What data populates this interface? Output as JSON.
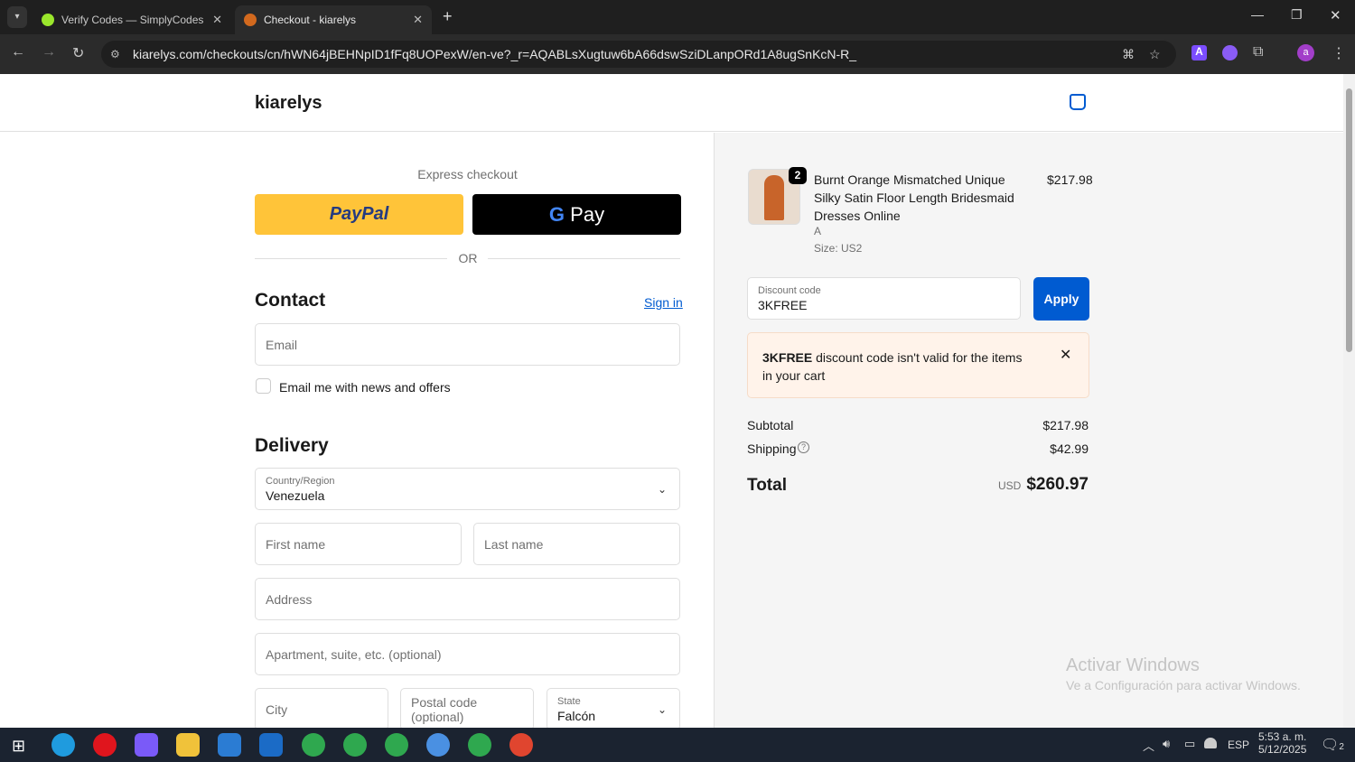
{
  "browser": {
    "tabs": [
      {
        "title": "Verify Codes — SimplyCodes"
      },
      {
        "title": "Checkout - kiarelys"
      }
    ],
    "url": "kiarelys.com/checkouts/cn/hWN64jBEHNpID1fFq8UOPexW/en-ve?_r=AQABLsXugtuw6bA66dswSziDLanpORd1A8ugSnKcN-R_",
    "profile_initial": "a"
  },
  "header": {
    "store_name": "kiarelys"
  },
  "checkout": {
    "express_label": "Express checkout",
    "paypal": "PayPal",
    "gpay": "Pay",
    "or": "OR",
    "contact": {
      "title": "Contact",
      "sign_in": "Sign in",
      "email_placeholder": "Email",
      "newsletter": "Email me with news and offers"
    },
    "delivery": {
      "title": "Delivery",
      "country_label": "Country/Region",
      "country": "Venezuela",
      "first_name": "First name",
      "last_name": "Last name",
      "address": "Address",
      "apartment": "Apartment, suite, etc. (optional)",
      "city": "City",
      "postal": "Postal code (optional)",
      "state_label": "State",
      "state": "Falcón"
    }
  },
  "summary": {
    "item": {
      "quantity": "2",
      "name": "Burnt Orange Mismatched Unique Silky Satin Floor Length Bridesmaid Dresses Online",
      "variant": "A",
      "size": "Size: US2",
      "price": "$217.98"
    },
    "discount_label": "Discount code",
    "discount_value": "3KFREE",
    "apply": "Apply",
    "error_code": "3KFREE",
    "error_text": " discount code isn't valid for the items in your cart",
    "subtotal_label": "Subtotal",
    "subtotal": "$217.98",
    "shipping_label": "Shipping",
    "shipping": "$42.99",
    "total_label": "Total",
    "currency": "USD",
    "total": "$260.97"
  },
  "watermark": {
    "title": "Activar Windows",
    "subtitle": "Ve a Configuración para activar Windows."
  },
  "taskbar": {
    "lang": "ESP",
    "time": "5:53 a. m.",
    "date": "5/12/2025",
    "notifications": "2"
  },
  "colors": {
    "accent": "#005bd1",
    "paypal": "#ffc439",
    "error_bg": "#fff3ea"
  }
}
